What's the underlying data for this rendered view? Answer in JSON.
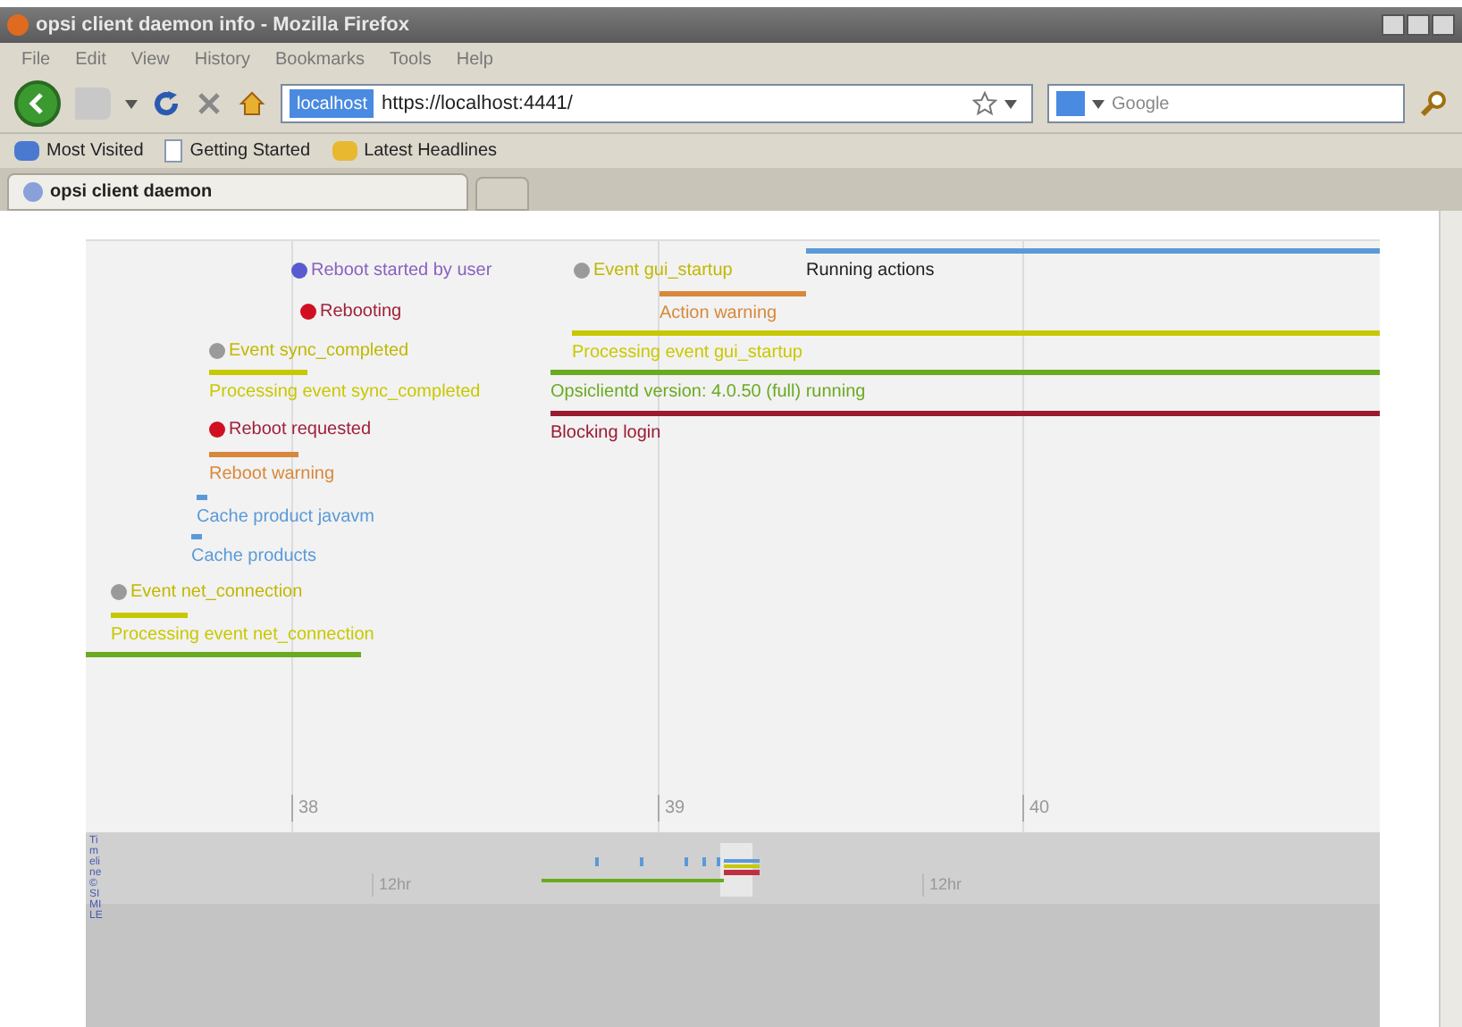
{
  "window": {
    "title": "opsi client daemon info - Mozilla Firefox"
  },
  "menu": [
    "File",
    "Edit",
    "View",
    "History",
    "Bookmarks",
    "Tools",
    "Help"
  ],
  "address": {
    "site": "localhost",
    "url": "https://localhost:4441/"
  },
  "search": {
    "placeholder": "Google"
  },
  "bookmarks": [
    {
      "label": "Most Visited",
      "kind": "blue"
    },
    {
      "label": "Getting Started",
      "kind": "page"
    },
    {
      "label": "Latest Headlines",
      "kind": "feed"
    }
  ],
  "tabs": [
    {
      "label": "opsi client daemon",
      "selected": true
    }
  ],
  "timeline": {
    "events": [
      {
        "kind": "user",
        "label": "Reboot started by user",
        "color": "#5a5ad0"
      },
      {
        "kind": "reboot",
        "label": "Rebooting",
        "color": "#d01020"
      },
      {
        "kind": "event",
        "label": "Event gui_startup",
        "color": "#9a9a9a"
      },
      {
        "kind": "action",
        "label": "Running actions",
        "color": "#5a9ad8"
      },
      {
        "kind": "duration",
        "label": "Action warning",
        "color": "#d8883a"
      },
      {
        "kind": "duration",
        "label": "Processing event gui_startup",
        "color": "#c8c800"
      },
      {
        "kind": "duration",
        "label": "Opsiclientd version: 4.0.50 (full) running",
        "color": "#6aaa20"
      },
      {
        "kind": "duration",
        "label": "Blocking login",
        "color": "#9a1a30"
      },
      {
        "kind": "event",
        "label": "Event sync_completed",
        "color": "#9a9a9a"
      },
      {
        "kind": "duration",
        "label": "Processing event sync_completed",
        "color": "#c8c800"
      },
      {
        "kind": "reboot",
        "label": "Reboot requested",
        "color": "#d01020"
      },
      {
        "kind": "duration",
        "label": "Reboot warning",
        "color": "#d8883a"
      },
      {
        "kind": "duration",
        "label": "Cache product javavm",
        "color": "#5a9ad8"
      },
      {
        "kind": "duration",
        "label": "Cache products",
        "color": "#5a9ad8"
      },
      {
        "kind": "event",
        "label": "Event net_connection",
        "color": "#9a9a9a"
      },
      {
        "kind": "duration",
        "label": "Processing event net_connection",
        "color": "#c8c800"
      },
      {
        "kind": "duration",
        "color": "#6aaa20"
      }
    ],
    "ticks": [
      "38",
      "39",
      "40"
    ],
    "overview_labels": [
      "12hr",
      "12hr"
    ],
    "credit": "Timeline © SIMILE"
  }
}
